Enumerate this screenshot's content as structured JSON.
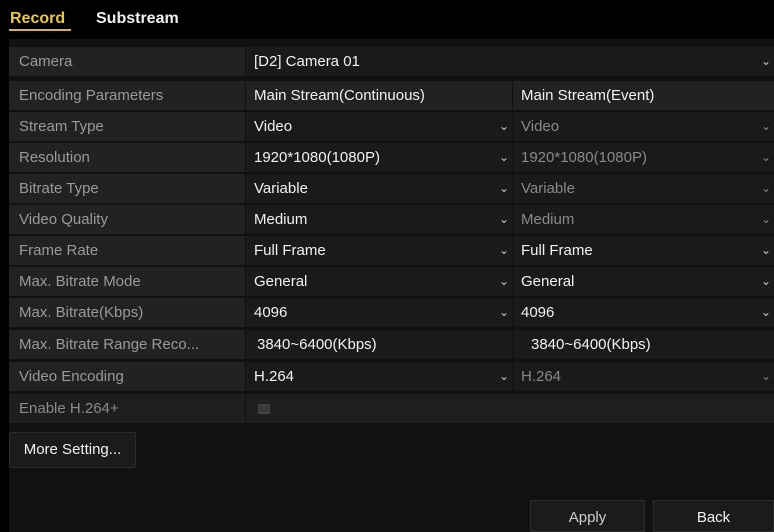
{
  "tabs": [
    {
      "label": "Record"
    },
    {
      "label": "Substream"
    }
  ],
  "camera": {
    "label": "Camera",
    "value": "[D2] Camera 01"
  },
  "encoding_header": {
    "label": "Encoding Parameters",
    "main": "Main Stream(Continuous)",
    "event": "Main Stream(Event)"
  },
  "rows": {
    "stream_type": {
      "label": "Stream Type",
      "main": "Video",
      "event": "Video"
    },
    "resolution": {
      "label": "Resolution",
      "main": "1920*1080(1080P)",
      "event": "1920*1080(1080P)"
    },
    "bitrate_type": {
      "label": "Bitrate Type",
      "main": "Variable",
      "event": "Variable"
    },
    "video_quality": {
      "label": "Video Quality",
      "main": "Medium",
      "event": "Medium"
    },
    "frame_rate": {
      "label": "Frame Rate",
      "main": "Full Frame",
      "event": "Full Frame"
    },
    "max_bitrate_mode": {
      "label": "Max. Bitrate Mode",
      "main": "General",
      "event": "General"
    },
    "max_bitrate": {
      "label": "Max. Bitrate(Kbps)",
      "main": "4096",
      "event": "4096"
    },
    "max_bitrate_range": {
      "label": "Max. Bitrate Range Reco...",
      "main": "3840~6400(Kbps)",
      "event": "3840~6400(Kbps)"
    },
    "video_encoding": {
      "label": "Video Encoding",
      "main": "H.264",
      "event": "H.264"
    }
  },
  "enable_h264plus": {
    "label": "Enable H.264+",
    "checked": false
  },
  "buttons": {
    "more_setting": "More Setting...",
    "apply": "Apply",
    "back": "Back"
  },
  "colors": {
    "active_tab": "#e8c84a",
    "background": "#000000",
    "label_cell": "#222222",
    "value_cell": "#1a1a1a"
  }
}
